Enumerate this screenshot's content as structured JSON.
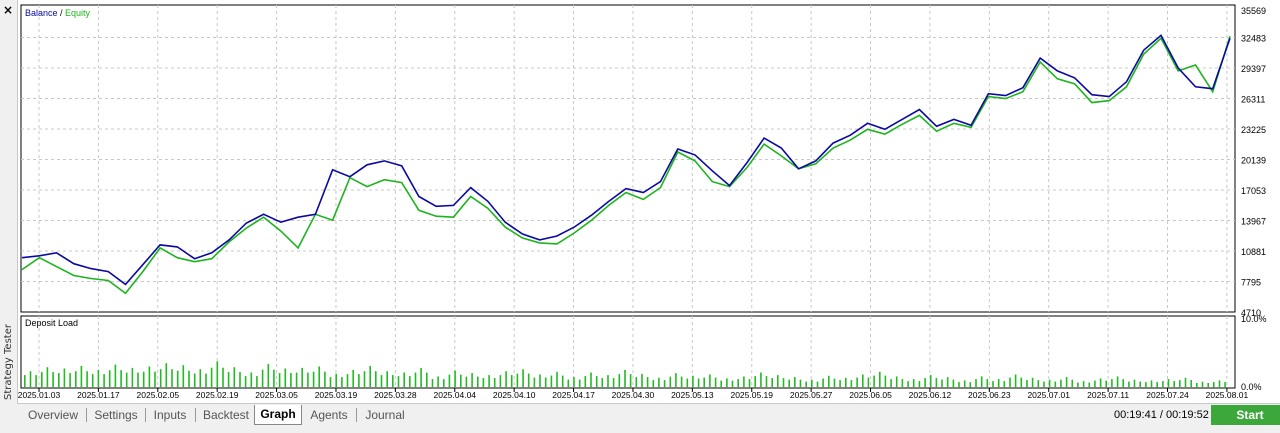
{
  "sidebar": {
    "close_label": "×",
    "title": "Strategy Tester"
  },
  "colors": {
    "balance": "#0a0aa0",
    "equity": "#1eb41e",
    "deposit_load": "#22bb22",
    "grid": "#c8c8c8"
  },
  "chart_data": [
    {
      "type": "line",
      "legend": {
        "items": [
          {
            "label": "Balance",
            "color": "#0a0aa0"
          },
          {
            "label": "Equity",
            "color": "#1eb41e"
          }
        ],
        "separator": " / ",
        "placement": "top-left"
      },
      "y_ticks": [
        35569,
        32483,
        29397,
        26311,
        23225,
        20139,
        17053,
        13967,
        10881,
        7795,
        4710
      ],
      "ylim": [
        4710,
        35569
      ],
      "x_ticks": [
        "2025.01.03",
        "2025.01.17",
        "2025.02.05",
        "2025.02.19",
        "2025.03.05",
        "2025.03.19",
        "2025.03.28",
        "2025.04.04",
        "2025.04.10",
        "2025.04.17",
        "2025.04.30",
        "2025.05.13",
        "2025.05.19",
        "2025.05.27",
        "2025.06.05",
        "2025.06.12",
        "2025.06.23",
        "2025.07.01",
        "2025.07.11",
        "2025.07.24",
        "2025.08.01"
      ],
      "grid": true,
      "series": [
        {
          "name": "Balance",
          "values": [
            10200,
            10400,
            10700,
            9600,
            9100,
            8800,
            7500,
            9500,
            11500,
            11300,
            10100,
            10700,
            12000,
            13700,
            14600,
            13800,
            14300,
            14600,
            19100,
            18400,
            19600,
            20000,
            19500,
            16400,
            15400,
            15500,
            17300,
            15900,
            13800,
            12600,
            12000,
            12400,
            13300,
            14500,
            15900,
            17200,
            16800,
            17900,
            21200,
            20600,
            19000,
            17500,
            19800,
            22300,
            21300,
            19200,
            20000,
            21800,
            22600,
            23800,
            23200,
            24200,
            25200,
            23500,
            24200,
            23600,
            26800,
            26600,
            27400,
            30400,
            29100,
            28400,
            26700,
            26500,
            28000,
            31200,
            32700,
            29400,
            27500,
            27300,
            32400
          ],
          "equity": [
            9000,
            10200,
            9300,
            8400,
            8100,
            7900,
            6600,
            8800,
            11200,
            10200,
            9800,
            10100,
            11800,
            13200,
            14300,
            12900,
            11200,
            14600,
            14000,
            18300,
            17400,
            18100,
            17800,
            15000,
            14400,
            14300,
            16400,
            15200,
            13300,
            12200,
            11700,
            11600,
            12700,
            14000,
            15500,
            16800,
            16100,
            17300,
            20900,
            20000,
            17900,
            17400,
            19300,
            21700,
            20500,
            19200,
            19700,
            21300,
            22100,
            23200,
            22700,
            23700,
            24600,
            23000,
            23800,
            23400,
            26500,
            26300,
            27000,
            30000,
            28300,
            27800,
            25900,
            26100,
            27500,
            30800,
            32400,
            29100,
            29700,
            27000,
            32600
          ]
        }
      ]
    },
    {
      "type": "bar",
      "title": "Deposit Load",
      "y_ticks": [
        "10.0%",
        "0.0%"
      ],
      "ylim": [
        0,
        10
      ],
      "unit": "%",
      "values": [
        2.4,
        3.0,
        2.8,
        3.2,
        2.6,
        3.4,
        2.9,
        3.1,
        3.6,
        3.3,
        2.7,
        3.9,
        3.0,
        2.2,
        3.5,
        2.8,
        2.9,
        3.1,
        2.0,
        2.6,
        3.2,
        2.4,
        2.2,
        2.9,
        1.6,
        2.5,
        2.1,
        1.8,
        2.4,
        2.7,
        1.9,
        2.3,
        1.5,
        2.2,
        1.8,
        2.6,
        2.0,
        1.4,
        2.1,
        1.7,
        1.9,
        1.3,
        1.6,
        2.2,
        1.8,
        1.5,
        1.1,
        1.7,
        1.4,
        1.9,
        2.3,
        1.6,
        1.2,
        1.8,
        1.5,
        1.0,
        1.6,
        1.2,
        1.9,
        1.4,
        1.1,
        1.5,
        0.9,
        1.3,
        1.6,
        1.1,
        1.0,
        1.2,
        1.4,
        0.8,
        1.0
      ]
    }
  ],
  "tabs": [
    {
      "label": "Overview",
      "active": false
    },
    {
      "label": "Settings",
      "active": false
    },
    {
      "label": "Inputs",
      "active": false
    },
    {
      "label": "Backtest",
      "active": false
    },
    {
      "label": "Graph",
      "active": true
    },
    {
      "label": "Agents",
      "active": false
    },
    {
      "label": "Journal",
      "active": false
    }
  ],
  "footer": {
    "timer": "00:19:41 / 00:19:52",
    "start_label": "Start"
  }
}
